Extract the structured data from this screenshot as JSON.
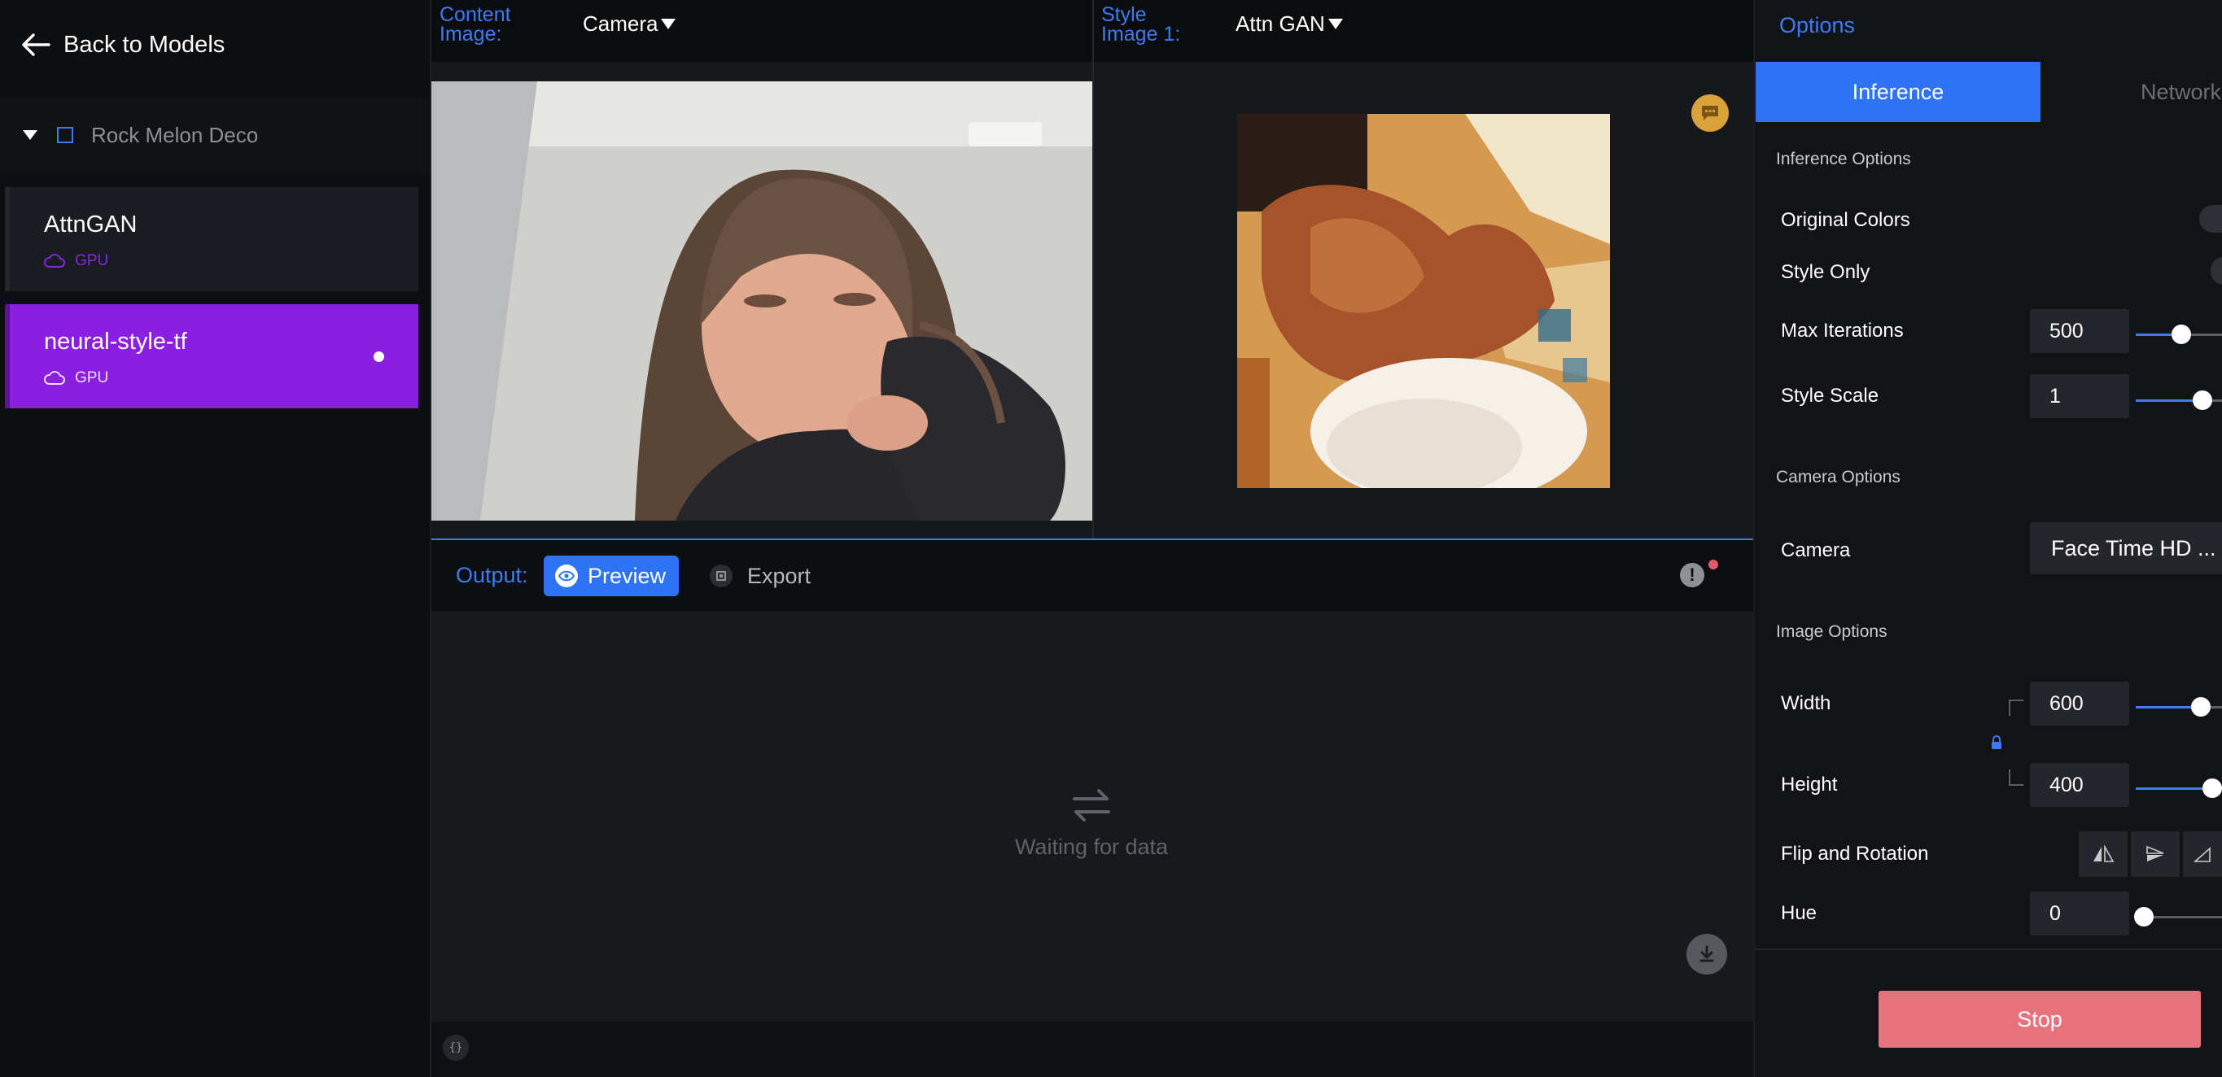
{
  "sidebar": {
    "back_label": "Back to Models",
    "project_name": "Rock Melon Deco",
    "models": [
      {
        "name": "AttnGAN",
        "hardware": "GPU"
      },
      {
        "name": "neural-style-tf",
        "hardware": "GPU"
      }
    ]
  },
  "content": {
    "label": "Content Image:",
    "source": "Camera"
  },
  "style": {
    "label": "Style Image 1:",
    "source": "Attn GAN"
  },
  "output": {
    "label": "Output:",
    "preview_label": "Preview",
    "export_label": "Export",
    "waiting_text": "Waiting for data"
  },
  "options": {
    "title": "Options",
    "tabs": [
      "Inference",
      "Network"
    ],
    "inference_section": "Inference Options",
    "original_colors": "Original Colors",
    "style_only": "Style Only",
    "max_iterations": {
      "label": "Max Iterations",
      "value": "500"
    },
    "style_scale": {
      "label": "Style Scale",
      "value": "1"
    },
    "camera_section": "Camera Options",
    "camera": {
      "label": "Camera",
      "value": "Face Time HD ..."
    },
    "image_section": "Image Options",
    "width": {
      "label": "Width",
      "value": "600"
    },
    "height": {
      "label": "Height",
      "value": "400"
    },
    "flip_label": "Flip and Rotation",
    "hue": {
      "label": "Hue",
      "value": "0"
    },
    "stop_label": "Stop"
  },
  "colors": {
    "accent": "#3d7bf5",
    "selected_model": "#8a1fe0",
    "stop": "#e8727c"
  },
  "icons": [
    "arrow-left-icon",
    "chevron-down-icon",
    "cloud-icon",
    "chat-icon",
    "eye-icon",
    "export-icon",
    "warning-icon",
    "swap-icon",
    "download-icon",
    "lock-icon",
    "code-icon"
  ]
}
